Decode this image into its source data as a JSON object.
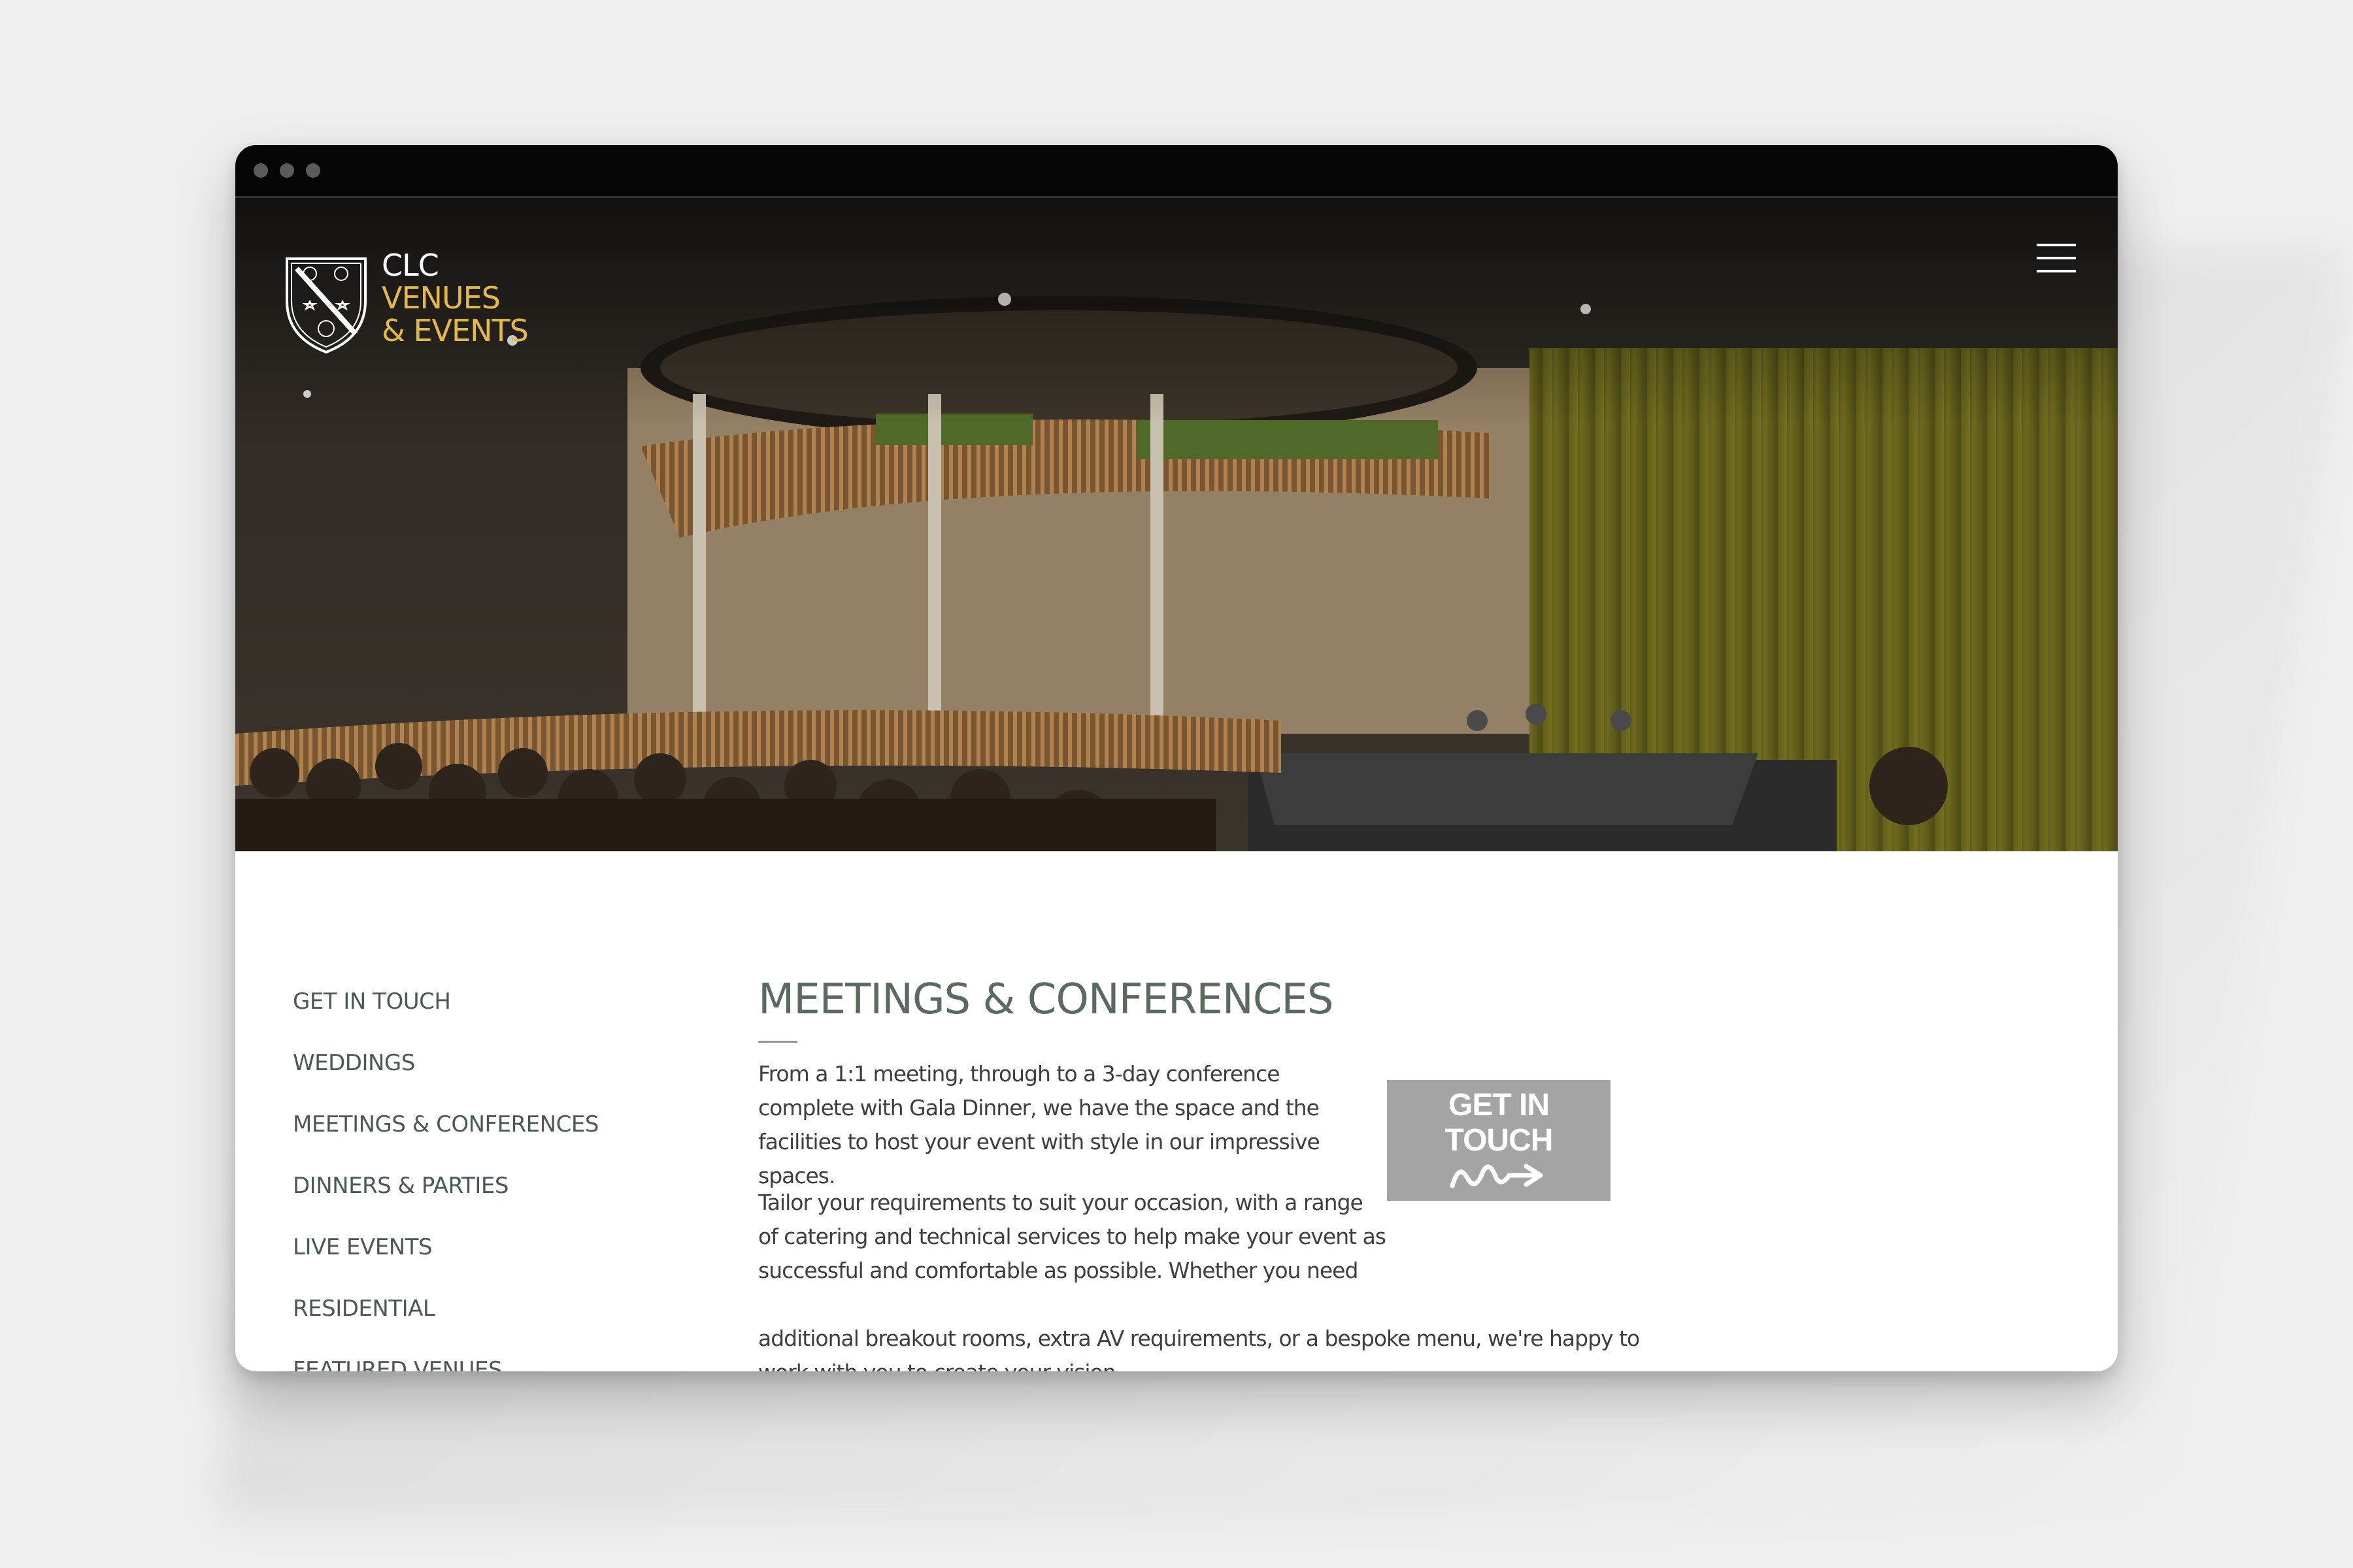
{
  "window": {
    "titlebar_dots": 3
  },
  "header": {
    "logo_line1": "CLC",
    "logo_line2": "VENUES",
    "logo_line3": "& EVENTS",
    "menu_icon": "hamburger-menu-icon"
  },
  "sidebar": {
    "items": [
      {
        "label": "GET IN TOUCH"
      },
      {
        "label": "WEDDINGS"
      },
      {
        "label": "MEETINGS & CONFERENCES"
      },
      {
        "label": "DINNERS & PARTIES"
      },
      {
        "label": "LIVE EVENTS"
      },
      {
        "label": "RESIDENTIAL"
      },
      {
        "label": "FEATURED VENUES"
      }
    ]
  },
  "main": {
    "title": "MEETINGS & CONFERENCES",
    "paragraphs": [
      "From a 1:1 meeting, through to a 3-day conference complete with Gala Dinner, we have the space and the facilities to host your event with style in our impressive spaces.",
      "Tailor your requirements to suit your occasion, with a range of catering and technical services to help make your event as successful and comfortable as possible. Whether you need",
      "additional breakout rooms, extra AV requirements, or a bespoke menu, we're happy to work with you to create your vision."
    ],
    "cta_line1": "GET IN",
    "cta_line2": "TOUCH"
  },
  "colors": {
    "accent_gold": "#e4b94a",
    "nav_text": "#4a5a4f",
    "cta_bg": "#a4a4a4",
    "titlebar": "#050505"
  }
}
